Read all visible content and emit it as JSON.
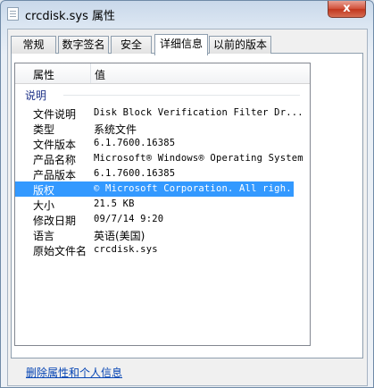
{
  "window": {
    "title": "crcdisk.sys 属性",
    "close_label": "x"
  },
  "tabs": [
    {
      "label": "常规"
    },
    {
      "label": "数字签名"
    },
    {
      "label": "安全"
    },
    {
      "label": "详细信息",
      "active": true
    },
    {
      "label": "以前的版本"
    }
  ],
  "details": {
    "header": {
      "property": "属性",
      "value": "值"
    },
    "group_label": "说明",
    "rows": [
      {
        "key": "文件说明",
        "value": "Disk Block Verification Filter Dr..."
      },
      {
        "key": "类型",
        "value": "系统文件"
      },
      {
        "key": "文件版本",
        "value": "6.1.7600.16385"
      },
      {
        "key": "产品名称",
        "value": "Microsoft® Windows® Operating System"
      },
      {
        "key": "产品版本",
        "value": "6.1.7600.16385"
      },
      {
        "key": "版权",
        "value": "© Microsoft Corporation. All righ...",
        "selected": true
      },
      {
        "key": "大小",
        "value": "21.5 KB"
      },
      {
        "key": "修改日期",
        "value": "09/7/14 9:20"
      },
      {
        "key": "语言",
        "value": "英语(美国)"
      },
      {
        "key": "原始文件名",
        "value": "crcdisk.sys"
      }
    ]
  },
  "footer": {
    "remove_link": "删除属性和个人信息"
  },
  "colors": {
    "selection": "#3399ff",
    "link": "#0645b4",
    "group": "#1e3287"
  }
}
